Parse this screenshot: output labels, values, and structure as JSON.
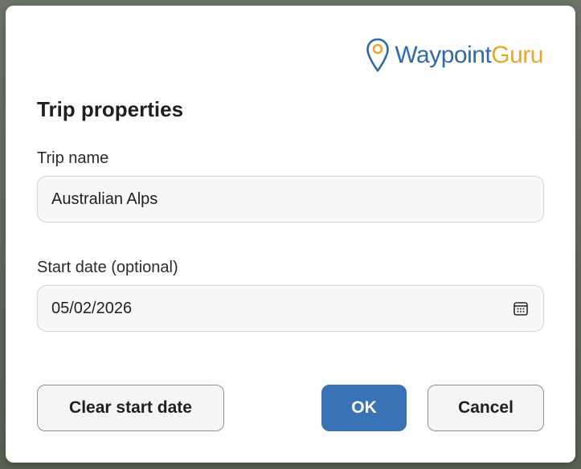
{
  "brand": {
    "name_part1": "Waypoint",
    "name_part2": "Guru",
    "primary_color": "#2f6aa8",
    "accent_color": "#e7a72a",
    "icon": "map-pin-icon"
  },
  "dialog": {
    "title": "Trip properties",
    "trip_name_label": "Trip name",
    "trip_name_value": "Australian Alps",
    "start_date_label": "Start date (optional)",
    "start_date_value": "05/02/2026",
    "calendar_icon": "calendar-icon"
  },
  "buttons": {
    "clear_label": "Clear start date",
    "ok_label": "OK",
    "cancel_label": "Cancel",
    "primary_color": "#3a73b5"
  }
}
